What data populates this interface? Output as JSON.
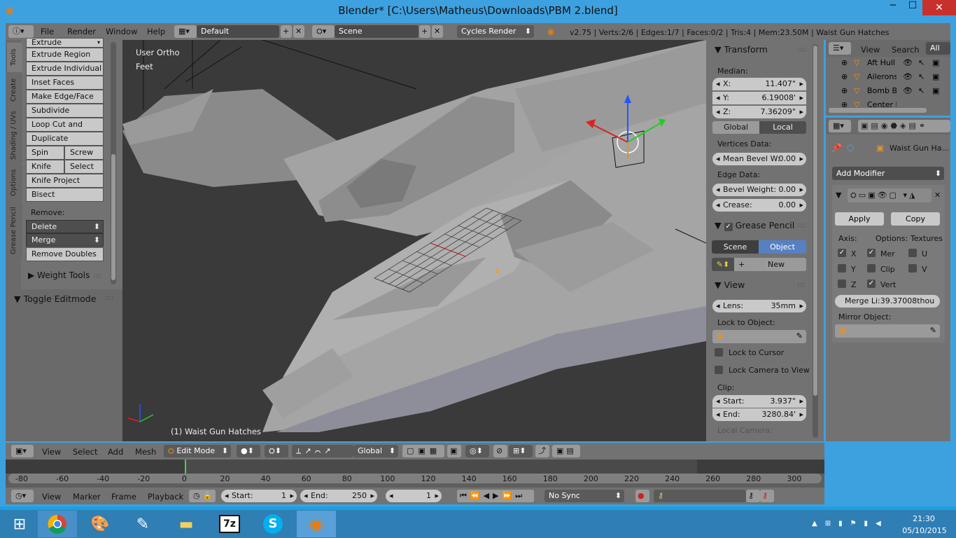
{
  "window": {
    "title": "Blender* [C:\\Users\\Matheus\\Downloads\\PBM 2.blend]",
    "minimize": "─",
    "maximize": "☐",
    "close": "✕"
  },
  "menu": {
    "file": "File",
    "render": "Render",
    "window": "Window",
    "help": "Help"
  },
  "layout": {
    "screen": "Default",
    "scene": "Scene",
    "engine": "Cycles Render"
  },
  "stats": "v2.75 | Verts:2/6 | Edges:1/7 | Faces:0/2 | Tris:4 | Mem:23.50M | Waist Gun Hatches",
  "tools": {
    "tabs": [
      "Tools",
      "Create",
      "Shading / UVs",
      "Options",
      "Grease Pencil"
    ],
    "buttons": [
      "Extrude",
      "Extrude Region",
      "Extrude Individual",
      "Inset Faces",
      "Make Edge/Face",
      "Subdivide",
      "Loop Cut and Slide",
      "Duplicate"
    ],
    "spin": "Spin",
    "screw": "Screw",
    "knife": "Knife",
    "select": "Select",
    "knife_project": "Knife Project",
    "bisect": "Bisect",
    "remove_label": "Remove:",
    "delete": "Delete",
    "merge": "Merge",
    "remove_doubles": "Remove Doubles",
    "weight_tools": "Weight Tools",
    "toggle_editmode": "Toggle Editmode"
  },
  "viewport": {
    "view_name": "User Ortho",
    "units": "Feet",
    "object_info": "(1) Waist Gun Hatches"
  },
  "npanel": {
    "transform": "Transform",
    "median": "Median:",
    "x_label": "X:",
    "x": "11.407\"",
    "y_label": "Y:",
    "y": "6.19008'",
    "z_label": "Z:",
    "z": "7.36209\"",
    "global": "Global",
    "local": "Local",
    "vertices_data": "Vertices Data:",
    "mean_bevel": "Mean Bevel W:",
    "mean_bevel_val": "0.00",
    "edge_data": "Edge Data:",
    "bevel_weight": "Bevel Weight:",
    "bevel_weight_val": "0.00",
    "crease": "Crease:",
    "crease_val": "0.00",
    "grease_pencil": "Grease Pencil",
    "gp_scene": "Scene",
    "gp_object": "Object",
    "gp_new": "New",
    "view": "View",
    "lens": "Lens:",
    "lens_val": "35mm",
    "lock_to_object": "Lock to Object:",
    "lock_to_cursor": "Lock to Cursor",
    "lock_camera": "Lock Camera to View",
    "clip": "Clip:",
    "start": "Start:",
    "start_val": "3.937\"",
    "end": "End:",
    "end_val": "3280.84'",
    "local_camera": "Local Camera:"
  },
  "outliner": {
    "view": "View",
    "search": "Search",
    "all_scenes": "All Sc",
    "items": [
      "Aft Hull S",
      "Ailerons",
      "Bomb Ba",
      "Center H"
    ]
  },
  "properties": {
    "object_name": "Waist Gun Ha...",
    "add_modifier": "Add Modifier",
    "apply": "Apply",
    "copy": "Copy",
    "axis": "Axis:",
    "options": "Options:",
    "textures": "Textures",
    "ax": [
      "X",
      "Y",
      "Z"
    ],
    "opts": [
      "Mer",
      "Clip",
      "Vert"
    ],
    "tex": [
      "U",
      "V"
    ],
    "merge_limit": "Merge Li:39.37008thou",
    "mirror_object": "Mirror Object:"
  },
  "header3d": {
    "view": "View",
    "select": "Select",
    "add": "Add",
    "mesh": "Mesh",
    "mode": "Edit Mode",
    "orientation": "Global"
  },
  "timeline": {
    "ticks": [
      "-80",
      "-60",
      "-40",
      "-20",
      "0",
      "20",
      "40",
      "60",
      "80",
      "100",
      "120",
      "140",
      "160",
      "180",
      "200",
      "220",
      "240",
      "260",
      "280",
      "300"
    ],
    "current_frame": 0
  },
  "tlheader": {
    "view": "View",
    "marker": "Marker",
    "frame": "Frame",
    "playback": "Playback",
    "start": "Start:",
    "start_val": "1",
    "end": "End:",
    "end_val": "250",
    "current": "1",
    "sync": "No Sync"
  },
  "taskbar": {
    "time": "21:30",
    "date": "05/10/2015",
    "icons": [
      "chrome-icon",
      "paint-icon",
      "tool-icon",
      "folder-icon",
      "7zip-icon",
      "skype-icon",
      "blender-icon"
    ]
  }
}
